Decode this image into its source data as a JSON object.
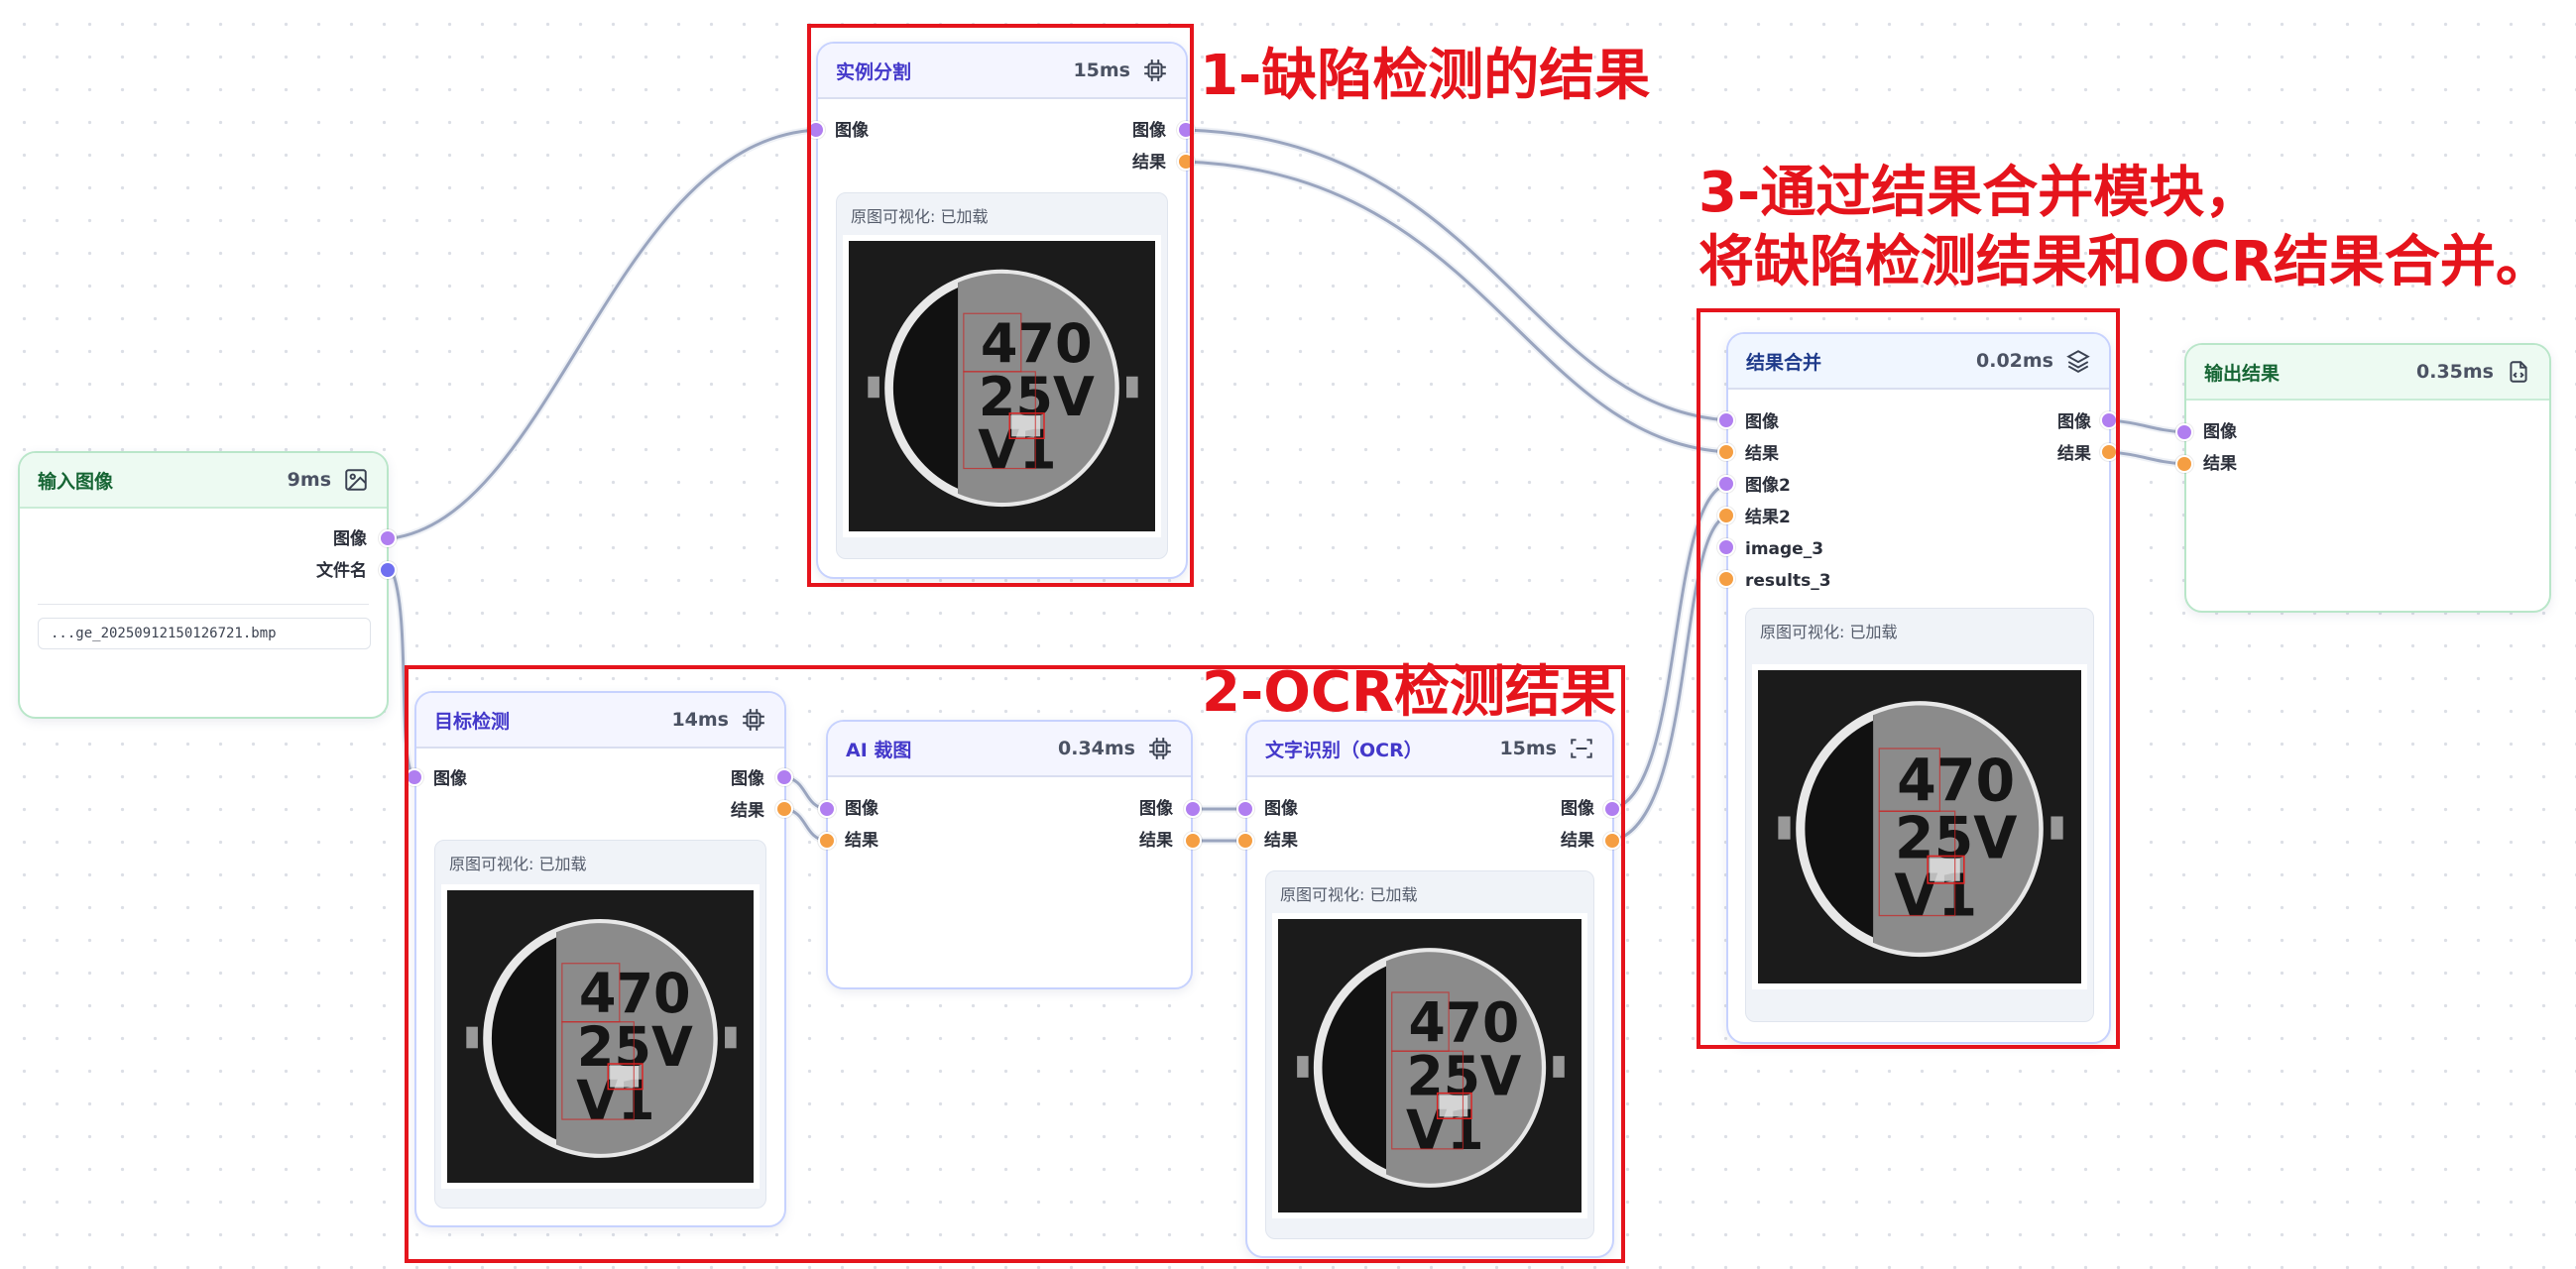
{
  "colors": {
    "edge": "#9aa5bf",
    "port_image": "#b07ef0",
    "port_result": "#f59e42",
    "port_filename": "#6f6ff0",
    "annotation": "#e5141c"
  },
  "preview_label": "原图可视化: 已加载",
  "image_text": {
    "line1": "470",
    "line2": "25V",
    "line3": "V1"
  },
  "nodes": {
    "input_image": {
      "title": "输入图像",
      "time": "9ms",
      "icon": "image-icon",
      "outputs": [
        "图像",
        "文件名"
      ],
      "file_value": "...ge_20250912150126721.bmp"
    },
    "instance_seg": {
      "title": "实例分割",
      "time": "15ms",
      "icon": "chip-icon",
      "inputs": [
        "图像"
      ],
      "outputs": [
        "图像",
        "结果"
      ]
    },
    "object_det": {
      "title": "目标检测",
      "time": "14ms",
      "icon": "chip-icon",
      "inputs": [
        "图像"
      ],
      "outputs": [
        "图像",
        "结果"
      ]
    },
    "ai_crop": {
      "title": "AI 裁图",
      "time": "0.34ms",
      "icon": "chip-icon",
      "inputs": [
        "图像",
        "结果"
      ],
      "outputs": [
        "图像",
        "结果"
      ]
    },
    "ocr": {
      "title": "文字识别（OCR）",
      "time": "15ms",
      "icon": "scan-icon",
      "inputs": [
        "图像",
        "结果"
      ],
      "outputs": [
        "图像",
        "结果"
      ]
    },
    "merge": {
      "title": "结果合并",
      "time": "0.02ms",
      "icon": "layers-icon",
      "inputs": [
        "图像",
        "结果",
        "图像2",
        "结果2",
        "image_3",
        "results_3"
      ],
      "outputs": [
        "图像",
        "结果"
      ]
    },
    "output": {
      "title": "输出结果",
      "time": "0.35ms",
      "icon": "file-icon",
      "inputs": [
        "图像",
        "结果"
      ]
    }
  },
  "annotations": {
    "a1": "1-缺陷检测的结果",
    "a2": "2-OCR检测结果",
    "a3_line1": "3-通过结果合并模块，",
    "a3_line2": "将缺陷检测结果和OCR结果合并。"
  }
}
